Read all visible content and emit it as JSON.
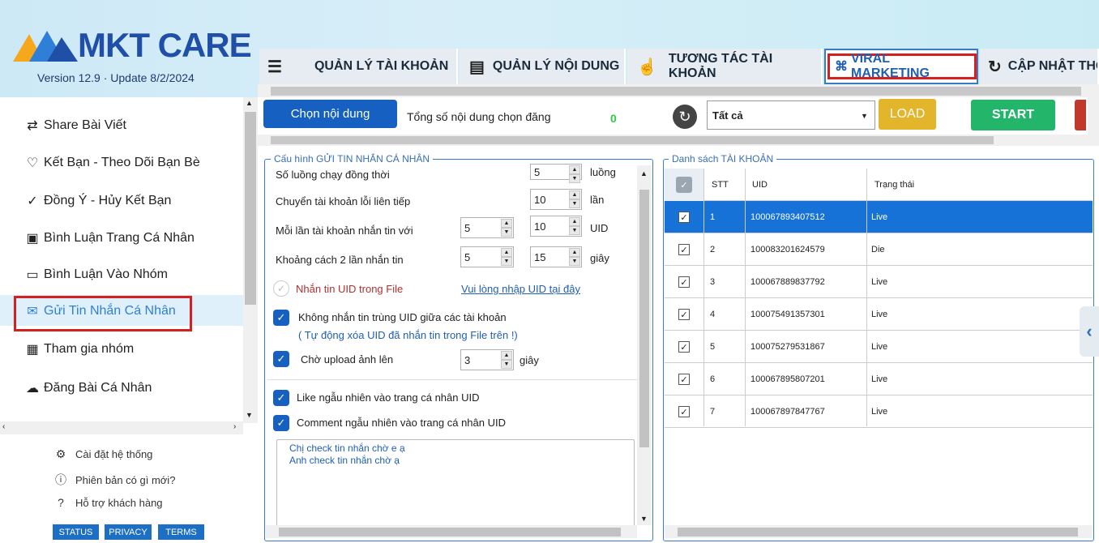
{
  "app": {
    "logo_text": "MKT CARE",
    "version": "Version  12.9 · Update  8/2/2024"
  },
  "tabs": [
    {
      "label": "QUẢN LÝ TÀI KHOẢN",
      "icon": "list-search-icon"
    },
    {
      "label": "QUẢN LÝ NỘI DUNG",
      "icon": "document-icon"
    },
    {
      "label": "TƯƠNG TÁC TÀI KHOẢN",
      "icon": "hand-pointer-icon"
    },
    {
      "label": "VIRAL MARKETING",
      "icon": "network-icon",
      "active": true
    },
    {
      "label": "CẬP NHẬT THO",
      "icon": "refresh-icon"
    }
  ],
  "sidebar": {
    "items": [
      {
        "label": "Share Bài Viết",
        "icon": "share-arrows-icon"
      },
      {
        "label": "Kết Bạn - Theo Dõi Bạn Bè",
        "icon": "heart-icon"
      },
      {
        "label": "Đồng Ý - Hủy Kết Bạn",
        "icon": "check-circle-icon"
      },
      {
        "label": "Bình Luận Trang Cá Nhân",
        "icon": "profile-card-icon"
      },
      {
        "label": "Bình Luận Vào Nhóm",
        "icon": "comment-icon"
      },
      {
        "label": "Gửi Tin Nhắn Cá Nhân",
        "icon": "mail-icon",
        "active": true
      },
      {
        "label": "Tham gia nhóm",
        "icon": "group-icon"
      },
      {
        "label": "Đăng Bài Cá Nhân",
        "icon": "cloud-upload-icon"
      }
    ],
    "bottom_links": [
      {
        "label": "Cài đặt hệ thống",
        "icon": "gear-icon"
      },
      {
        "label": "Phiên bản có gì mới?",
        "icon": "info-icon"
      },
      {
        "label": "Hỗ trợ khách hàng",
        "icon": "help-icon"
      }
    ],
    "badges": [
      "STATUS",
      "PRIVACY",
      "TERMS"
    ]
  },
  "toolbar": {
    "choose_content": "Chọn nội dung",
    "total_label": "Tổng số nội dung chọn đăng",
    "total_count": "0",
    "filter_value": "Tất cả",
    "load": "LOAD",
    "start": "START"
  },
  "config": {
    "title": "Cấu hình GỬI TIN NHẮN CÁ NHÂN",
    "threads_label": "Số luồng chạy đồng thời",
    "threads_value": "5",
    "threads_unit": "luồng",
    "switch_label": "Chuyển tài khoản lỗi liên tiếp",
    "switch_value": "10",
    "switch_unit": "lần",
    "each_label": "Mỗi lần tài khoản nhắn tin với",
    "each_min": "5",
    "each_max": "10",
    "each_unit": "UID",
    "gap_label": "Khoảng cách 2 lần nhắn tin",
    "gap_min": "5",
    "gap_max": "15",
    "gap_unit": "giây",
    "uid_file_label": "Nhắn tin UID trong File",
    "uid_file_link": "Vui lòng nhập  UID tại đây",
    "no_dup_label": "Không nhắn tin trùng UID giữa các tài khoản",
    "no_dup_note": "( Tự động xóa UID đã nhắn tin trong File trên !)",
    "wait_upload_label": "Chờ upload ảnh lên",
    "wait_upload_value": "3",
    "wait_upload_unit": "giây",
    "like_label": "Like ngẫu nhiên vào trang cá nhân UID",
    "comment_label": "Comment ngẫu nhiên vào trang cá nhân UID",
    "messages": [
      "Chị check tin nhắn chờ e ạ",
      "Anh check tin nhắn chờ ạ"
    ]
  },
  "accounts": {
    "title": "Danh sách TÀI KHOẢN",
    "columns": [
      "STT",
      "UID",
      "Trạng thái"
    ],
    "rows": [
      {
        "stt": "1",
        "uid": "100067893407512",
        "status": "Live"
      },
      {
        "stt": "2",
        "uid": "100083201624579",
        "status": "Die"
      },
      {
        "stt": "3",
        "uid": "100067889837792",
        "status": "Live"
      },
      {
        "stt": "4",
        "uid": "100075491357301",
        "status": "Live"
      },
      {
        "stt": "5",
        "uid": "100075279531867",
        "status": "Live"
      },
      {
        "stt": "6",
        "uid": "100067895807201",
        "status": "Live"
      },
      {
        "stt": "7",
        "uid": "100067897847767",
        "status": "Live"
      }
    ]
  },
  "colors": {
    "primary": "#1560c0",
    "load": "#e2b52a",
    "start": "#23b56a",
    "highlight": "#d62020",
    "selected_row": "#1672d6"
  }
}
